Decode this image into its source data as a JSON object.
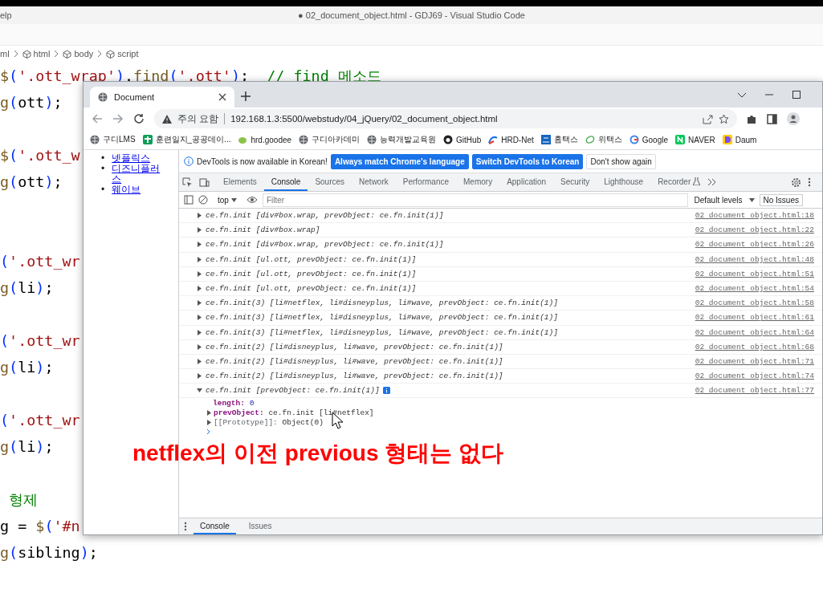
{
  "editor": {
    "menu": "elp",
    "title": "● 02_document_object.html - GDJ69 - Visual Studio Code",
    "breadcrumbs": [
      "ml",
      "html",
      "body",
      "script"
    ],
    "lines": [
      {
        "kind": "code",
        "tokens": [
          {
            "kind": "fn",
            "text": "$"
          },
          {
            "kind": "paren",
            "text": "("
          },
          {
            "kind": "str",
            "text": "'.ott_wrap'"
          },
          {
            "kind": "paren",
            "text": ")"
          },
          {
            "kind": "plain",
            "text": "."
          },
          {
            "kind": "fn",
            "text": "find"
          },
          {
            "kind": "paren",
            "text": "("
          },
          {
            "kind": "str",
            "text": "'.ott'"
          },
          {
            "kind": "paren",
            "text": ")"
          },
          {
            "kind": "plain",
            "text": ";  "
          },
          {
            "kind": "comment",
            "text": "// find 메소드"
          }
        ]
      },
      {
        "kind": "code",
        "tokens": [
          {
            "kind": "fn",
            "text": "g"
          },
          {
            "kind": "paren",
            "text": "("
          },
          {
            "kind": "plain",
            "text": "ott"
          },
          {
            "kind": "paren",
            "text": ")"
          },
          {
            "kind": "plain",
            "text": ";"
          }
        ]
      },
      {
        "kind": "blank"
      },
      {
        "kind": "code",
        "tokens": [
          {
            "kind": "fn",
            "text": "$"
          },
          {
            "kind": "paren",
            "text": "("
          },
          {
            "kind": "str",
            "text": "'.ott_w"
          }
        ]
      },
      {
        "kind": "code",
        "tokens": [
          {
            "kind": "fn",
            "text": "g"
          },
          {
            "kind": "paren",
            "text": "("
          },
          {
            "kind": "plain",
            "text": "ott"
          },
          {
            "kind": "paren",
            "text": ")"
          },
          {
            "kind": "plain",
            "text": ";"
          }
        ]
      },
      {
        "kind": "blank"
      },
      {
        "kind": "blank"
      },
      {
        "kind": "code",
        "tokens": [
          {
            "kind": "paren",
            "text": "("
          },
          {
            "kind": "str",
            "text": "'.ott_wr"
          }
        ]
      },
      {
        "kind": "code",
        "tokens": [
          {
            "kind": "fn",
            "text": "g"
          },
          {
            "kind": "paren",
            "text": "("
          },
          {
            "kind": "plain",
            "text": "li"
          },
          {
            "kind": "paren",
            "text": ")"
          },
          {
            "kind": "plain",
            "text": ";"
          }
        ]
      },
      {
        "kind": "blank"
      },
      {
        "kind": "code",
        "tokens": [
          {
            "kind": "paren",
            "text": "("
          },
          {
            "kind": "str",
            "text": "'.ott_wr"
          }
        ]
      },
      {
        "kind": "code",
        "tokens": [
          {
            "kind": "fn",
            "text": "g"
          },
          {
            "kind": "paren",
            "text": "("
          },
          {
            "kind": "plain",
            "text": "li"
          },
          {
            "kind": "paren",
            "text": ")"
          },
          {
            "kind": "plain",
            "text": ";"
          }
        ]
      },
      {
        "kind": "blank"
      },
      {
        "kind": "code",
        "tokens": [
          {
            "kind": "paren",
            "text": "("
          },
          {
            "kind": "str",
            "text": "'.ott_wr"
          }
        ]
      },
      {
        "kind": "code",
        "tokens": [
          {
            "kind": "fn",
            "text": "g"
          },
          {
            "kind": "paren",
            "text": "("
          },
          {
            "kind": "plain",
            "text": "li"
          },
          {
            "kind": "paren",
            "text": ")"
          },
          {
            "kind": "plain",
            "text": ";"
          }
        ]
      },
      {
        "kind": "blank"
      },
      {
        "kind": "code",
        "tokens": [
          {
            "kind": "comment",
            "text": " 형제"
          }
        ]
      },
      {
        "kind": "code",
        "tokens": [
          {
            "kind": "plain",
            "text": "g = "
          },
          {
            "kind": "fn",
            "text": "$"
          },
          {
            "kind": "paren",
            "text": "("
          },
          {
            "kind": "str",
            "text": "'#n"
          }
        ]
      },
      {
        "kind": "code",
        "tokens": [
          {
            "kind": "fn",
            "text": "g"
          },
          {
            "kind": "paren",
            "text": "("
          },
          {
            "kind": "plain",
            "text": "sibling"
          },
          {
            "kind": "paren",
            "text": ")"
          },
          {
            "kind": "plain",
            "text": ";"
          }
        ]
      }
    ]
  },
  "browser": {
    "tab": {
      "title": "Document"
    },
    "address": {
      "warning": "주의 요함",
      "url": "192.168.1.3:5500/webstudy/04_jQuery/02_document_object.html"
    },
    "bookmarks": [
      "구디LMS",
      "훈련일지_공공데이...",
      "hrd.goodee",
      "구디아카데미",
      "능력개발교육원",
      "GitHub",
      "HRD-Net",
      "홈택스",
      "위택스",
      "Google",
      "NAVER",
      "Daum"
    ],
    "page": {
      "links": [
        {
          "marker": "•",
          "label": "넷플릭스"
        },
        {
          "marker": "•",
          "label": "디즈니플러스"
        },
        {
          "marker": "•",
          "label": "웨이브"
        }
      ]
    },
    "devtools": {
      "notice": "DevTools is now available in Korean!",
      "notice_buttons": [
        {
          "label": "Always match Chrome's language",
          "kind": "primary"
        },
        {
          "label": "Switch DevTools to Korean",
          "kind": "primary"
        },
        {
          "label": "Don't show again",
          "kind": "plain"
        }
      ],
      "tabs": [
        {
          "label": "Elements",
          "selected": false
        },
        {
          "label": "Console",
          "selected": true
        },
        {
          "label": "Sources",
          "selected": false
        },
        {
          "label": "Network",
          "selected": false
        },
        {
          "label": "Performance",
          "selected": false
        },
        {
          "label": "Memory",
          "selected": false
        },
        {
          "label": "Application",
          "selected": false
        },
        {
          "label": "Security",
          "selected": false
        },
        {
          "label": "Lighthouse",
          "selected": false
        },
        {
          "label": "Recorder",
          "selected": false
        }
      ],
      "context": "top",
      "filter_placeholder": "Filter",
      "levels": "Default levels",
      "issues": "No Issues",
      "logs": [
        {
          "text": "ce.fn.init [div#box.wrap, prevObject: ce.fn.init(1)]",
          "source": "02 document object.html:18",
          "expanded": false
        },
        {
          "text": "ce.fn.init [div#box.wrap]",
          "source": "02 document object.html:22",
          "expanded": false
        },
        {
          "text": "ce.fn.init [div#box.wrap, prevObject: ce.fn.init(1)]",
          "source": "02 document object.html:26",
          "expanded": false
        },
        {
          "text": "ce.fn.init [ul.ott, prevObject: ce.fn.init(1)]",
          "source": "02 document object.html:48",
          "expanded": false
        },
        {
          "text": "ce.fn.init [ul.ott, prevObject: ce.fn.init(1)]",
          "source": "02 document object.html:51",
          "expanded": false
        },
        {
          "text": "ce.fn.init [ul.ott, prevObject: ce.fn.init(1)]",
          "source": "02 document object.html:54",
          "expanded": false
        },
        {
          "text": "ce.fn.init(3) [li#netflex, li#disneyplus, li#wave, prevObject: ce.fn.init(1)]",
          "source": "02 document object.html:58",
          "expanded": false
        },
        {
          "text": "ce.fn.init(3) [li#netflex, li#disneyplus, li#wave, prevObject: ce.fn.init(1)]",
          "source": "02 document object.html:61",
          "expanded": false
        },
        {
          "text": "ce.fn.init(3) [li#netflex, li#disneyplus, li#wave, prevObject: ce.fn.init(1)]",
          "source": "02 document object.html:64",
          "expanded": false
        },
        {
          "text": "ce.fn.init(2) [li#disneyplus, li#wave, prevObject: ce.fn.init(1)]",
          "source": "02 document object.html:68",
          "expanded": false
        },
        {
          "text": "ce.fn.init(2) [li#disneyplus, li#wave, prevObject: ce.fn.init(1)]",
          "source": "02 document object.html:71",
          "expanded": false
        },
        {
          "text": "ce.fn.init(2) [li#disneyplus, li#wave, prevObject: ce.fn.init(1)]",
          "source": "02 document object.html:74",
          "expanded": false
        },
        {
          "text": "ce.fn.init [prevObject: ce.fn.init(1)]",
          "source": "02 document object.html:77",
          "expanded": true,
          "properties": [
            {
              "key": "length:",
              "value": "0",
              "expandable": false
            },
            {
              "key": "prevObject:",
              "value": "ce.fn.init [li#netflex]",
              "expandable": true
            },
            {
              "key": "[[Prototype]]:",
              "value": "Object(0)",
              "expandable": true,
              "kind": "internal"
            }
          ]
        }
      ],
      "drawer_tabs": [
        {
          "label": "Console",
          "selected": true
        },
        {
          "label": "Issues",
          "selected": false
        }
      ]
    }
  },
  "annotation": "netflex의 이전 previous 형태는 없다"
}
